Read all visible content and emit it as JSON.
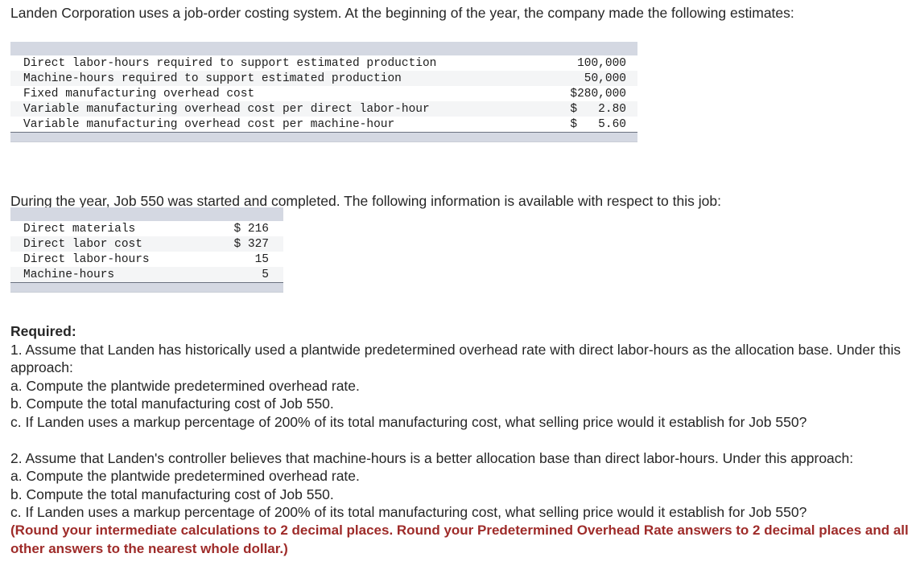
{
  "intro": {
    "paragraph_1": "Landen Corporation uses a job-order costing system. At the beginning of the year, the company made the following estimates:",
    "paragraph_2": "During the year, Job 550 was started and completed. The following information is available with respect to this job:"
  },
  "colors": {
    "table_header_bar": "#d4d8e2",
    "table_row_alt": "#f4f5f6",
    "table_footer_border": "#6b7280",
    "note_red": "#9e2b29",
    "body_text": "#262626"
  },
  "table_estimates": {
    "name": "beginning-of-year-estimates",
    "rows": [
      {
        "label": "Direct labor-hours required to support estimated production",
        "value": "100,000"
      },
      {
        "label": "Machine-hours required to support estimated production",
        "value": "50,000"
      },
      {
        "label": "Fixed manufacturing overhead cost",
        "value": "$280,000"
      },
      {
        "label": "Variable manufacturing overhead cost per direct labor-hour",
        "value": "$   2.80"
      },
      {
        "label": "Variable manufacturing overhead cost per machine-hour",
        "value": "$   5.60"
      }
    ]
  },
  "table_job550": {
    "name": "job-550-details",
    "rows": [
      {
        "label": "Direct materials",
        "value": "$ 216"
      },
      {
        "label": "Direct labor cost",
        "value": "$ 327"
      },
      {
        "label": "Direct labor-hours",
        "value": "15"
      },
      {
        "label": "Machine-hours",
        "value": "5"
      }
    ]
  },
  "required": {
    "heading": "Required:",
    "item_1_intro": "1. Assume that Landen has historically used a plantwide predetermined overhead rate with direct labor-hours as the allocation base. Under this approach:",
    "item_1_a": "a. Compute the plantwide predetermined overhead rate.",
    "item_1_b": "b. Compute the total manufacturing cost of Job 550.",
    "item_1_c": "c. If Landen uses a markup percentage of 200% of its total manufacturing cost, what selling price would it establish for Job 550?",
    "item_2_intro": "2. Assume that Landen's controller believes that machine-hours is a better allocation base than direct labor-hours. Under this approach:",
    "item_2_a": "a. Compute the plantwide predetermined overhead rate.",
    "item_2_b": "b. Compute the total manufacturing cost of Job 550.",
    "item_2_c": "c. If Landen uses a markup percentage of 200% of its total manufacturing cost, what selling price would it establish for Job 550?",
    "rounding_note": "(Round your intermediate calculations to 2 decimal places. Round your Predetermined Overhead Rate answers to 2 decimal places and all other answers to the nearest whole dollar.)"
  }
}
